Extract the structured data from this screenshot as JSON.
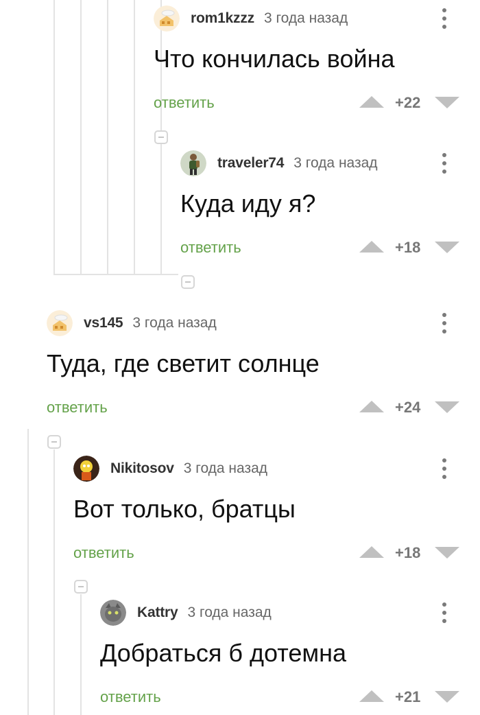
{
  "comments": [
    {
      "username": "rom1kzzz",
      "time": "3 года назад",
      "text": "Что кончилась война",
      "reply_label": "ответить",
      "score": "+22",
      "avatar": "default-avatar-icon"
    },
    {
      "username": "traveler74",
      "time": "3 года назад",
      "text": "Куда иду я?",
      "reply_label": "ответить",
      "score": "+18",
      "avatar": "traveler-avatar"
    },
    {
      "username": "vs145",
      "time": "3 года назад",
      "text": "Туда, где светит солнце",
      "reply_label": "ответить",
      "score": "+24",
      "avatar": "default-avatar-icon"
    },
    {
      "username": "Nikitosov",
      "time": "3 года назад",
      "text": "Вот только, братцы",
      "reply_label": "ответить",
      "score": "+18",
      "avatar": "cartoon-avatar"
    },
    {
      "username": "Kattry",
      "time": "3 года назад",
      "text": "Добраться б дотемна",
      "reply_label": "ответить",
      "score": "+21",
      "avatar": "cat-avatar"
    }
  ],
  "colors": {
    "reply": "#64a24a",
    "thread_line": "#e3e3e3",
    "vote_arrow": "#c0c0c0"
  }
}
